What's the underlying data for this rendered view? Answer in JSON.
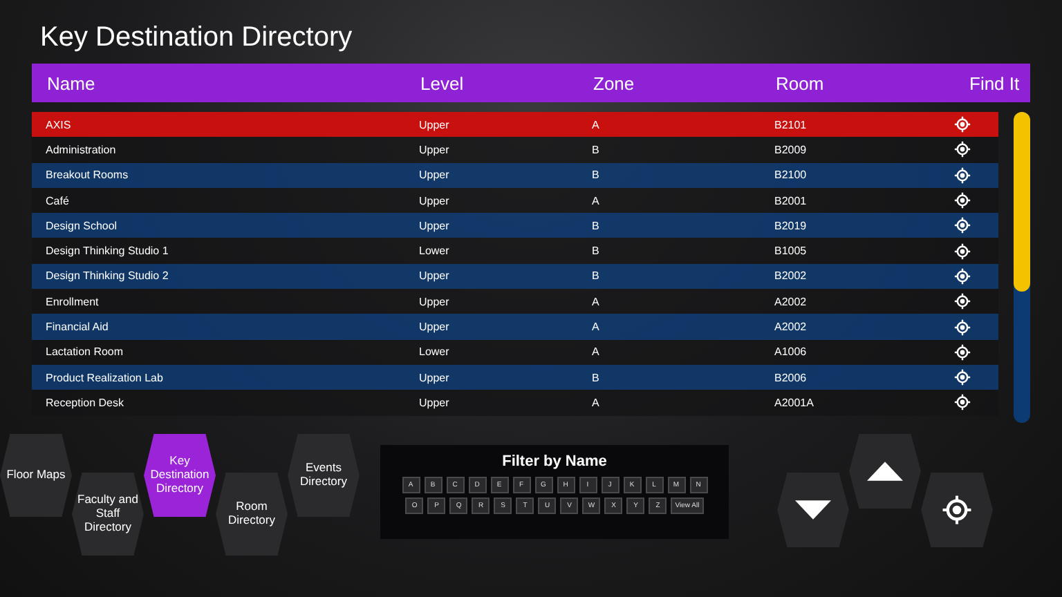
{
  "title": "Key Destination Directory",
  "table": {
    "columns": [
      "Name",
      "Level",
      "Zone",
      "Room",
      "Find It"
    ],
    "rows": [
      {
        "name": "AXIS",
        "level": "Upper",
        "zone": "A",
        "room": "B2101",
        "selected": true
      },
      {
        "name": "Administration",
        "level": "Upper",
        "zone": "B",
        "room": "B2009",
        "selected": false
      },
      {
        "name": "Breakout Rooms",
        "level": "Upper",
        "zone": "B",
        "room": "B2100",
        "selected": false
      },
      {
        "name": "Café",
        "level": "Upper",
        "zone": "A",
        "room": "B2001",
        "selected": false
      },
      {
        "name": "Design School",
        "level": "Upper",
        "zone": "B",
        "room": "B2019",
        "selected": false
      },
      {
        "name": "Design Thinking Studio 1",
        "level": "Lower",
        "zone": "B",
        "room": "B1005",
        "selected": false
      },
      {
        "name": "Design Thinking Studio 2",
        "level": "Upper",
        "zone": "B",
        "room": "B2002",
        "selected": false
      },
      {
        "name": "Enrollment",
        "level": "Upper",
        "zone": "A",
        "room": "A2002",
        "selected": false
      },
      {
        "name": "Financial Aid",
        "level": "Upper",
        "zone": "A",
        "room": "A2002",
        "selected": false
      },
      {
        "name": "Lactation Room",
        "level": "Lower",
        "zone": "A",
        "room": "A1006",
        "selected": false
      },
      {
        "name": "Product Realization Lab",
        "level": "Upper",
        "zone": "B",
        "room": "B2006",
        "selected": false
      },
      {
        "name": "Reception Desk",
        "level": "Upper",
        "zone": "A",
        "room": "A2001A",
        "selected": false
      }
    ]
  },
  "nav": [
    {
      "label": "Floor Maps",
      "selected": false
    },
    {
      "label": "Faculty and Staff Directory",
      "selected": false
    },
    {
      "label": "Key Destination Directory",
      "selected": true
    },
    {
      "label": "Room Directory",
      "selected": false
    },
    {
      "label": "Events Directory",
      "selected": false
    }
  ],
  "filter": {
    "title": "Filter by Name",
    "keys": [
      [
        "A",
        "B",
        "C",
        "D",
        "E",
        "F",
        "G",
        "H",
        "I",
        "J",
        "K",
        "L",
        "M",
        "N"
      ],
      [
        "O",
        "P",
        "Q",
        "R",
        "S",
        "T",
        "U",
        "V",
        "W",
        "X",
        "Y",
        "Z",
        "View All"
      ]
    ]
  }
}
